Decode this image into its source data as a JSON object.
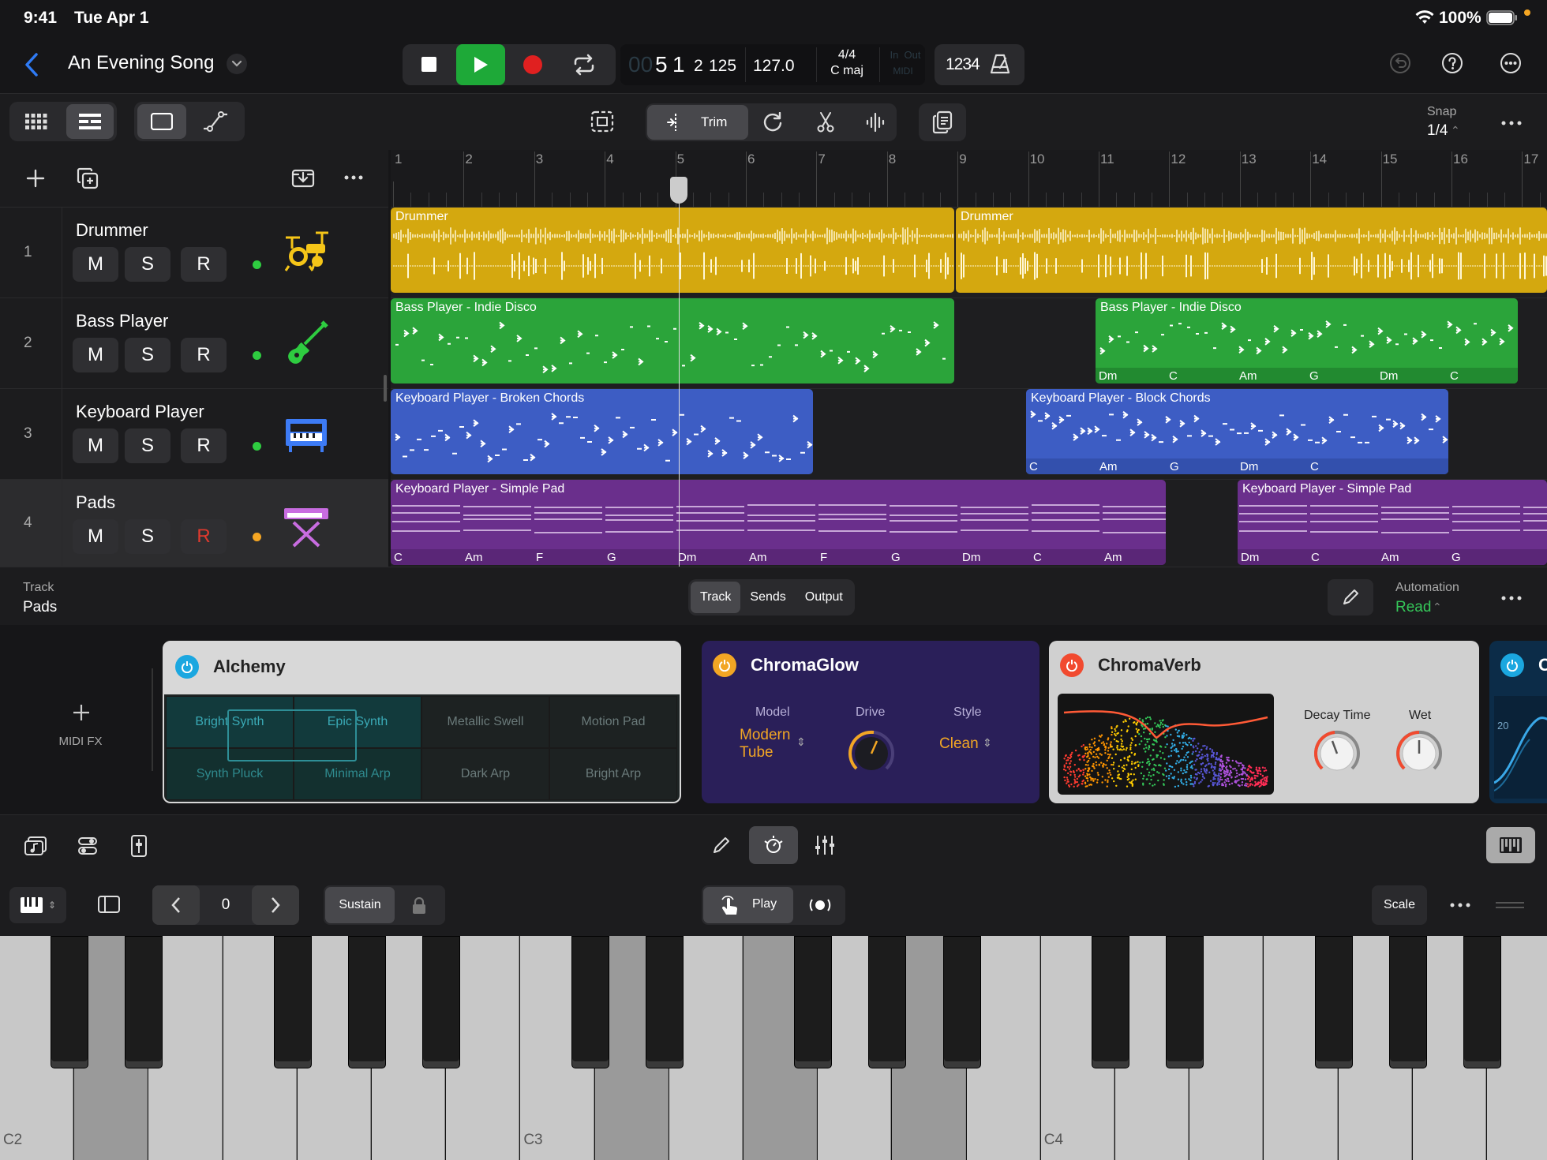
{
  "status": {
    "time": "9:41",
    "date": "Tue Apr 1",
    "battery": "100%"
  },
  "header": {
    "song_title": "An Evening Song",
    "lcd": {
      "bar": "5",
      "beat": "1",
      "div": "2",
      "tick": "125",
      "tempo": "127.0",
      "signature": "4/4",
      "key": "C maj",
      "in": "In",
      "out": "Out",
      "midi": "MIDI"
    },
    "count_in": "1234"
  },
  "toolbar": {
    "trim": "Trim",
    "snap_label": "Snap",
    "snap_value": "1/4"
  },
  "ruler": [
    "1",
    "2",
    "3",
    "4",
    "5",
    "6",
    "7",
    "8",
    "9",
    "10",
    "11",
    "12",
    "13",
    "14",
    "15",
    "16",
    "17"
  ],
  "tracks": [
    {
      "num": "1",
      "name": "Drummer",
      "m": "M",
      "s": "S",
      "r": "R",
      "dot": "#2ecc40",
      "icon": "drum-kit-icon"
    },
    {
      "num": "2",
      "name": "Bass Player",
      "m": "M",
      "s": "S",
      "r": "R",
      "dot": "#2ecc40",
      "icon": "bass-guitar-icon"
    },
    {
      "num": "3",
      "name": "Keyboard Player",
      "m": "M",
      "s": "S",
      "r": "R",
      "dot": "#2ecc40",
      "icon": "piano-icon"
    },
    {
      "num": "4",
      "name": "Pads",
      "m": "M",
      "s": "S",
      "r": "R",
      "dot": "#f5a623",
      "icon": "synth-keyboard-icon"
    }
  ],
  "regions": {
    "drummer1": "Drummer",
    "drummer2": "Drummer",
    "bass1": "Bass Player - Indie Disco",
    "bass2": "Bass Player - Indie Disco",
    "keys1": "Keyboard Player - Broken Chords",
    "keys2": "Keyboard Player - Block Chords",
    "pad1": "Keyboard Player - Simple Pad",
    "pad2": "Keyboard Player - Simple Pad"
  },
  "chords": {
    "bass2": [
      "Dm",
      "C",
      "Am",
      "G",
      "Dm",
      "C"
    ],
    "keys2": [
      "C",
      "Am",
      "G",
      "Dm",
      "C"
    ],
    "pad1": [
      "C",
      "Am",
      "F",
      "G",
      "Dm",
      "Am",
      "F",
      "G",
      "Dm",
      "C",
      "Am"
    ],
    "pad2": [
      "Dm",
      "C",
      "Am",
      "G"
    ]
  },
  "inspector": {
    "track_label": "Track",
    "track_name": "Pads",
    "tabs": [
      "Track",
      "Sends",
      "Output"
    ],
    "automation_label": "Automation",
    "automation_value": "Read",
    "midi_fx": "MIDI FX"
  },
  "alchemy": {
    "title": "Alchemy",
    "presets": [
      "Bright Synth",
      "Epic Synth",
      "Metallic Swell",
      "Motion Pad",
      "Synth Pluck",
      "Minimal Arp",
      "Dark Arp",
      "Bright Arp"
    ]
  },
  "chromaglow": {
    "title": "ChromaGlow",
    "model_label": "Model",
    "model_value_1": "Modern",
    "model_value_2": "Tube",
    "drive_label": "Drive",
    "style_label": "Style",
    "style_value": "Clean"
  },
  "chromaverb": {
    "title": "ChromaVerb",
    "decay_label": "Decay Time",
    "wet_label": "Wet"
  },
  "partial_plugin": {
    "title": "C",
    "value": "20"
  },
  "keyboard_bar": {
    "octave": "0",
    "sustain": "Sustain",
    "play": "Play",
    "scale": "Scale"
  },
  "keys": {
    "c2": "C2",
    "c3": "C3",
    "c4": "C4"
  },
  "colors": {
    "drummer": "#d4a80f",
    "bass": "#2ba43a",
    "keys": "#3d5dc4",
    "pads": "#6a2f8c",
    "accent": "#2f7bf5",
    "play": "#1ea938",
    "record": "#e02020"
  }
}
